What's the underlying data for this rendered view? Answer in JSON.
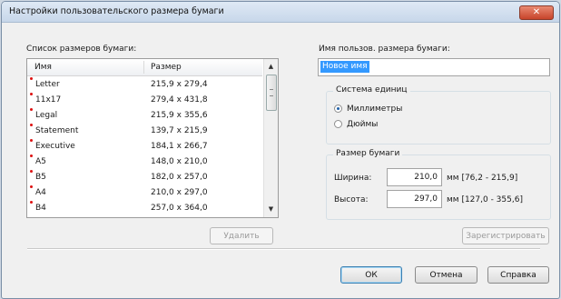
{
  "window": {
    "title": "Настройки пользовательского размера бумаги",
    "close_symbol": "✕"
  },
  "paper_list": {
    "label": "Список размеров бумаги:",
    "columns": [
      "Имя",
      "Размер"
    ],
    "rows": [
      {
        "name": "Letter",
        "size": "215,9 x 279,4"
      },
      {
        "name": "11x17",
        "size": "279,4 x 431,8"
      },
      {
        "name": "Legal",
        "size": "215,9 x 355,6"
      },
      {
        "name": "Statement",
        "size": "139,7 x 215,9"
      },
      {
        "name": "Executive",
        "size": "184,1 x 266,7"
      },
      {
        "name": "A5",
        "size": "148,0 x 210,0"
      },
      {
        "name": "B5",
        "size": "182,0 x 257,0"
      },
      {
        "name": "A4",
        "size": "210,0 x 297,0"
      },
      {
        "name": "B4",
        "size": "257,0 x 364,0"
      }
    ],
    "delete_label": "Удалить"
  },
  "custom_name": {
    "label": "Имя пользов. размера бумаги:",
    "value": "Новое имя"
  },
  "units": {
    "title": "Система единиц",
    "options": [
      "Миллиметры",
      "Дюймы"
    ],
    "selected": 0
  },
  "paper_size": {
    "title": "Размер бумаги",
    "width": {
      "label": "Ширина:",
      "value": "210,0",
      "range": "мм [76,2 - 215,9]"
    },
    "height": {
      "label": "Высота:",
      "value": "297,0",
      "range": "мм [127,0 - 355,6]"
    }
  },
  "buttons": {
    "register": "Зарегистрировать",
    "ok": "ОК",
    "cancel": "Отмена",
    "help": "Справка"
  }
}
